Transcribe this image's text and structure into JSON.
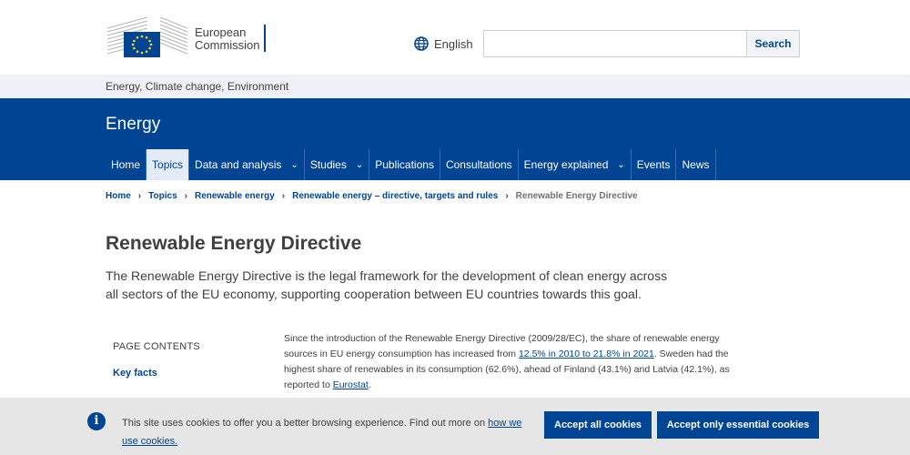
{
  "header": {
    "logo_line1": "European",
    "logo_line2": "Commission",
    "language_label": "English",
    "search_placeholder": "",
    "search_button": "Search"
  },
  "site_strip": {
    "label": "Energy, Climate change, Environment"
  },
  "banner": {
    "title": "Energy",
    "nav": [
      {
        "label": "Home",
        "active": false,
        "dropdown": false
      },
      {
        "label": "Topics",
        "active": true,
        "dropdown": false
      },
      {
        "label": "Data and analysis",
        "active": false,
        "dropdown": true
      },
      {
        "label": "Studies",
        "active": false,
        "dropdown": true
      },
      {
        "label": "Publications",
        "active": false,
        "dropdown": false
      },
      {
        "label": "Consultations",
        "active": false,
        "dropdown": false
      },
      {
        "label": "Energy explained",
        "active": false,
        "dropdown": true
      },
      {
        "label": "Events",
        "active": false,
        "dropdown": false
      },
      {
        "label": "News",
        "active": false,
        "dropdown": false
      }
    ]
  },
  "breadcrumb": {
    "items": [
      "Home",
      "Topics",
      "Renewable energy",
      "Renewable energy – directive, targets and rules"
    ],
    "current": "Renewable Energy Directive"
  },
  "page": {
    "title": "Renewable Energy Directive",
    "intro": "The Renewable Energy Directive is the legal framework for the development of clean energy across all sectors of the EU economy, supporting cooperation between EU countries towards this goal.",
    "toc_label": "PAGE CONTENTS",
    "toc_link": "Key facts",
    "body_part1": "Since the introduction of the Renewable Energy Directive (2009/28/EC), the share of renewable energy sources in EU energy consumption has increased from ",
    "body_link1": "12.5% in 2010 to 21.8% in 2021",
    "body_part2": ". Sweden had the highest share of renewables in its consumption (62.6%), ahead of Finland (43.1%) and Latvia (42.1%), as reported to ",
    "body_link2": "Eurostat",
    "body_part3": "."
  },
  "cookie": {
    "text": "This site uses cookies to offer you a better browsing experience. Find out more on ",
    "link": "how we use cookies.",
    "accept_all": "Accept all cookies",
    "accept_essential": "Accept only essential cookies"
  },
  "colors": {
    "brand_blue": "#004494",
    "strip_bg": "#eef2f8",
    "cookie_bg": "#e6e6e6"
  }
}
